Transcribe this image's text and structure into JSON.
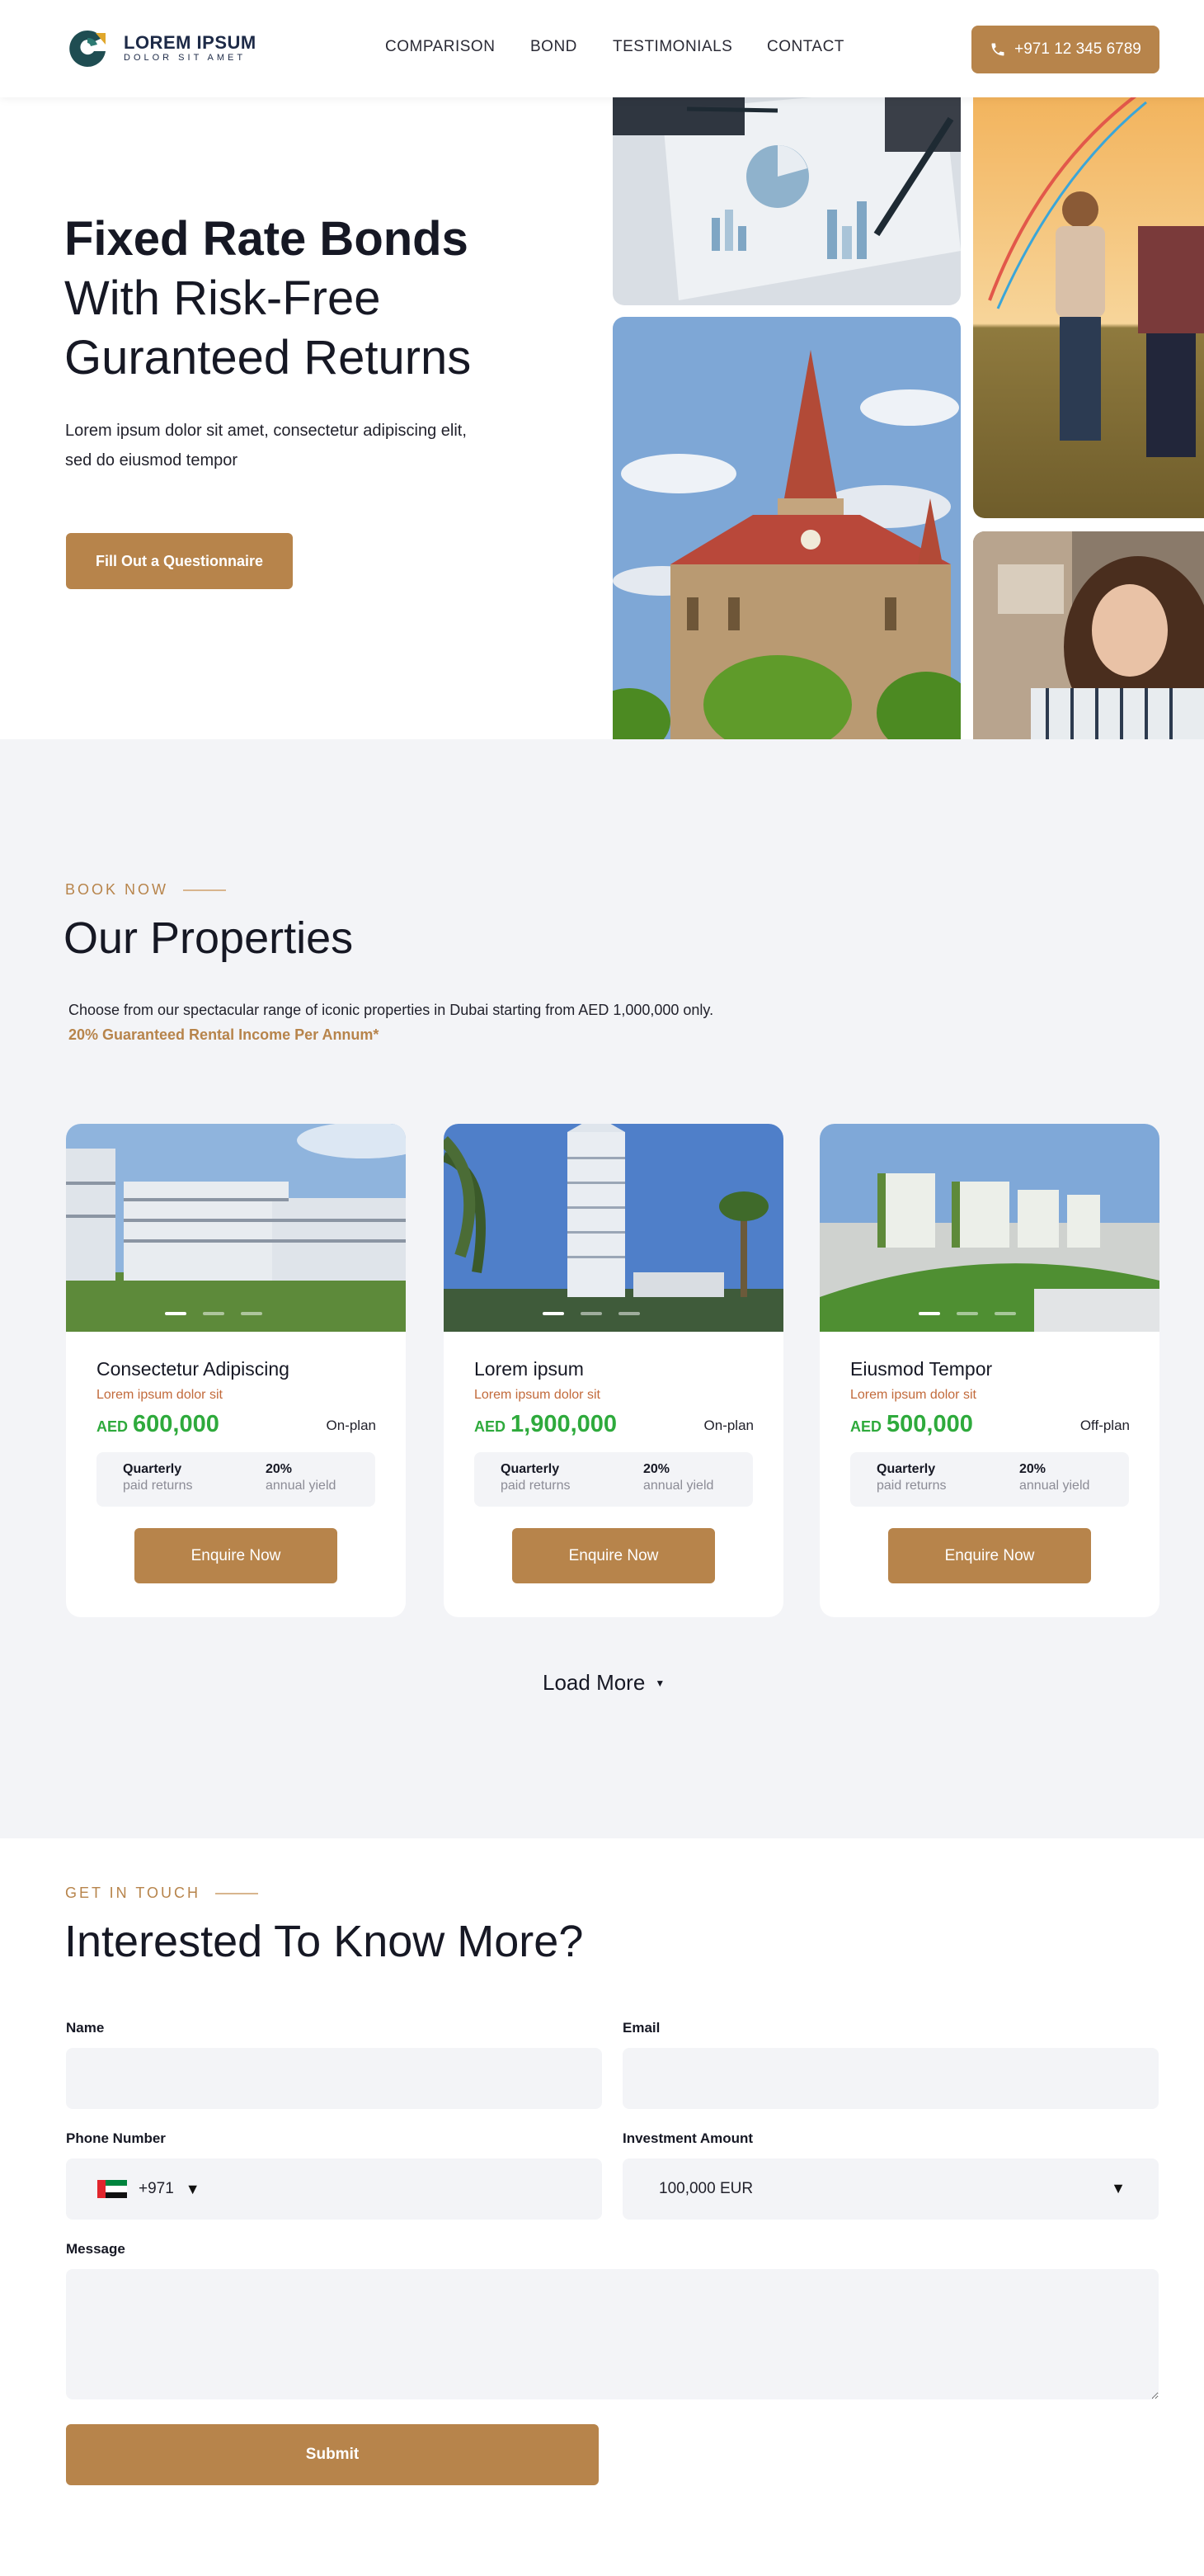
{
  "header": {
    "logo_title": "LOREM IPSUM",
    "logo_sub": "DOLOR SIT AMET",
    "nav": [
      {
        "label": "COMPARISON"
      },
      {
        "label": "BOND"
      },
      {
        "label": "TESTIMONIALS"
      },
      {
        "label": "CONTACT"
      }
    ],
    "phone": "+971 12 345 6789"
  },
  "hero": {
    "title_bold": "Fixed Rate Bonds",
    "title_line2": "With Risk-Free",
    "title_line3": "Guranteed Returns",
    "description": "Lorem ipsum dolor sit amet, consectetur adipiscing elit, sed do eiusmod tempor",
    "cta": "Fill Out a Questionnaire"
  },
  "properties": {
    "eyebrow": "BOOK NOW",
    "title": "Our Properties",
    "description": "Choose from our spectacular range of iconic properties in Dubai starting from AED 1,000,000 only.",
    "note": "20% Guaranteed Rental Income Per Annum*",
    "cards": [
      {
        "name": "Consectetur Adipiscing",
        "sub": "Lorem ipsum dolor sit",
        "currency": "AED",
        "price": "600,000",
        "status": "On-plan",
        "col1_title": "Quarterly",
        "col1_sub": "paid returns",
        "col2_title": "20%",
        "col2_sub": "annual yield",
        "button": "Enquire Now"
      },
      {
        "name": "Lorem ipsum",
        "sub": "Lorem ipsum dolor sit",
        "currency": "AED",
        "price": "1,900,000",
        "status": "On-plan",
        "col1_title": "Quarterly",
        "col1_sub": "paid returns",
        "col2_title": "20%",
        "col2_sub": "annual yield",
        "button": "Enquire Now"
      },
      {
        "name": "Eiusmod Tempor",
        "sub": "Lorem ipsum dolor sit",
        "currency": "AED",
        "price": "500,000",
        "status": "Off-plan",
        "col1_title": "Quarterly",
        "col1_sub": "paid returns",
        "col2_title": "20%",
        "col2_sub": "annual yield",
        "button": "Enquire Now"
      }
    ],
    "load_more": "Load More"
  },
  "contact": {
    "eyebrow": "GET IN TOUCH",
    "title": "Interested To Know More?",
    "name_label": "Name",
    "email_label": "Email",
    "phone_label": "Phone Number",
    "phone_code": "+971",
    "amount_label": "Investment Amount",
    "amount_value": "100,000 EUR",
    "message_label": "Message",
    "submit": "Submit"
  },
  "colors": {
    "accent": "#b7844b",
    "price_green": "#2eaa3c",
    "section_bg": "#f3f4f7"
  }
}
